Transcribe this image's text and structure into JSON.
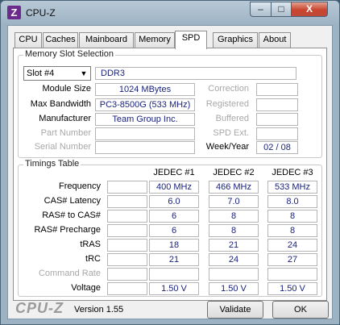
{
  "window": {
    "title": "CPU-Z",
    "icon_letter": "Z",
    "minimize": "–",
    "maximize": "□",
    "close": "X"
  },
  "tabs": [
    "CPU",
    "Caches",
    "Mainboard",
    "Memory",
    "SPD",
    "Graphics",
    "About"
  ],
  "active_tab": "SPD",
  "memory_slot": {
    "legend": "Memory Slot Selection",
    "slot_selected": "Slot #4",
    "type": "DDR3",
    "labels": {
      "module_size": "Module Size",
      "max_bandwidth": "Max Bandwidth",
      "manufacturer": "Manufacturer",
      "part_number": "Part Number",
      "serial_number": "Serial Number",
      "correction": "Correction",
      "registered": "Registered",
      "buffered": "Buffered",
      "spd_ext": "SPD Ext.",
      "week_year": "Week/Year"
    },
    "values": {
      "module_size": "1024 MBytes",
      "max_bandwidth": "PC3-8500G (533 MHz)",
      "manufacturer": "Team Group Inc.",
      "part_number": "",
      "serial_number": "",
      "correction": "",
      "registered": "",
      "buffered": "",
      "spd_ext": "",
      "week_year": "02 / 08"
    }
  },
  "timings": {
    "legend": "Timings Table",
    "columns": [
      "JEDEC #1",
      "JEDEC #2",
      "JEDEC #3"
    ],
    "rows": [
      {
        "label": "Frequency",
        "dim": false,
        "values": [
          "400 MHz",
          "466 MHz",
          "533 MHz"
        ]
      },
      {
        "label": "CAS# Latency",
        "dim": false,
        "values": [
          "6.0",
          "7.0",
          "8.0"
        ]
      },
      {
        "label": "RAS# to CAS#",
        "dim": false,
        "values": [
          "6",
          "8",
          "8"
        ]
      },
      {
        "label": "RAS# Precharge",
        "dim": false,
        "values": [
          "6",
          "8",
          "8"
        ]
      },
      {
        "label": "tRAS",
        "dim": false,
        "values": [
          "18",
          "21",
          "24"
        ]
      },
      {
        "label": "tRC",
        "dim": false,
        "values": [
          "21",
          "24",
          "27"
        ]
      },
      {
        "label": "Command Rate",
        "dim": true,
        "values": [
          "",
          "",
          ""
        ]
      },
      {
        "label": "Voltage",
        "dim": false,
        "values": [
          "1.50 V",
          "1.50 V",
          "1.50 V"
        ]
      }
    ]
  },
  "footer": {
    "logo": "CPU-Z",
    "version": "Version 1.55",
    "validate": "Validate",
    "ok": "OK"
  }
}
